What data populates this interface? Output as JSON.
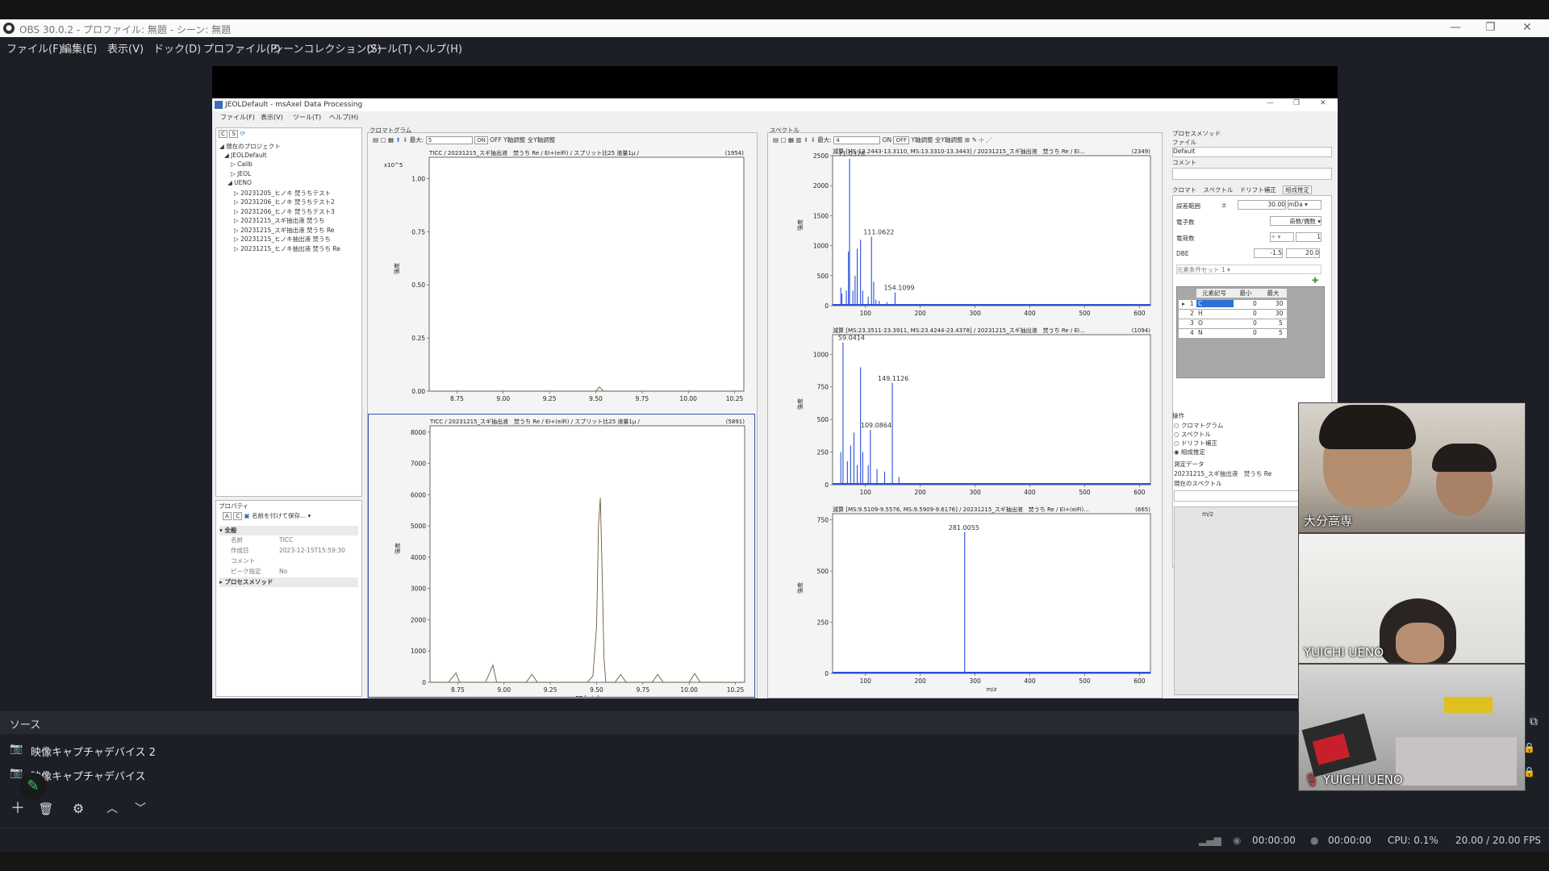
{
  "window": {
    "title": "OBS 30.0.2 - プロファイル: 無題 - シーン: 無題"
  },
  "menu": [
    "ファイル(F)",
    "編集(E)",
    "表示(V)",
    "ドック(D)",
    "プロファイル(P)",
    "シーンコレクション(S)",
    "ツール(T)",
    "ヘルプ(H)"
  ],
  "msaxel": {
    "title": "JEOLDefault - msAxel Data Processing",
    "menu": [
      "ファイル(F)",
      "表示(V)",
      "ツール(T)",
      "ヘルプ(H)"
    ],
    "tree": {
      "root": "現在のプロジェクト",
      "items": [
        "JEOLDefault",
        "Calib",
        "JEOL",
        "UENO",
        "20231205_ヒノキ 焚うちテスト",
        "20231206_ヒノキ 焚うちテスト2",
        "20231206_ヒノキ 焚うちテスト3",
        "20231215_スギ抽出液 焚うち",
        "20231215_スギ抽出液 焚うち Re",
        "20231215_ヒノキ抽出液 焚うち",
        "20231215_ヒノキ抽出液 焚うち Re"
      ]
    },
    "props": {
      "header": "プロパティ",
      "save_label": "名前を付けて保存...",
      "section": "全般",
      "rows": [
        {
          "k": "名前",
          "v": "TICC"
        },
        {
          "k": "作成日",
          "v": "2023-12-15T15:59:30"
        },
        {
          "k": "コメント",
          "v": ""
        },
        {
          "k": "ピーク指定",
          "v": "No"
        }
      ],
      "process": "プロセスメソッド"
    },
    "chrom": {
      "header": "クロマトグラム",
      "max_label": "最大:",
      "max_value": "5",
      "on": "ON",
      "off": "OFF",
      "yadjust": "Y軸調整",
      "yall": "全Y軸調整",
      "yunit_label": "強度",
      "plot1_title": "TICC / 20231215_スギ抽出液　焚うち Re / EI+(eiFi) / スプリット比25 液量1μ /",
      "plot1_count": "(1954)",
      "plot2_title": "TICC / 20231215_スギ抽出液　焚うち Re / EI+(eiFi) / スプリット比25 液量1μ /",
      "plot2_count": "(5891)",
      "exp": "x10",
      "exp_sup": "5",
      "xlabel": "RT [min]"
    },
    "spec": {
      "header": "スペクトル",
      "max_label": "最大:",
      "max_value": "4",
      "on": "ON",
      "off": "OFF",
      "yadjust": "Y軸調整",
      "yall": "全Y軸調整",
      "yunit_label": "強度",
      "s1_title": "減算 [MS:13.2443-13.3110, MS:13.3310-13.3443] / 20231215_スギ抽出液　焚うち Re / EI...",
      "s1_count": "(2349)",
      "s2_title": "減算 [MS:23.3511-23.3911, MS:23.4244-23.4378] / 20231215_スギ抽出液　焚うち Re / EI...",
      "s2_count": "(1094)",
      "s3_title": "減算 [MS:9.5109-9.5576, MS:9.5909-9.6176] / 20231215_スギ抽出液　焚うち Re / EI+(eiFi)...",
      "s3_count": "(665)",
      "xlabel": "m/z"
    },
    "method": {
      "header": "プロセスメソッド",
      "file_label": "ファイル",
      "file_value": "Default",
      "comment_label": "コメント",
      "tabs": [
        "クロマト",
        "スペクトル",
        "ドリフト補正",
        "組成推定"
      ],
      "range_label": "誤差範囲",
      "range_sign": "±",
      "range_value": "30.00",
      "range_unit": "mDa",
      "electron_label": "電子数",
      "electron_value": "奇数/偶数",
      "charge_label": "電荷数",
      "charge_sign": "+",
      "charge_value": "1",
      "dbe_label": "DBE",
      "dbe_min": "-1.5",
      "dbe_max": "20.0",
      "set_label": "元素条件セット 1",
      "table_headers": [
        "元素記号",
        "最小",
        "最大"
      ],
      "table_rows": [
        {
          "n": "1",
          "el": "C",
          "min": "0",
          "max": "30"
        },
        {
          "n": "2",
          "el": "H",
          "min": "0",
          "max": "30"
        },
        {
          "n": "3",
          "el": "O",
          "min": "0",
          "max": "5"
        },
        {
          "n": "4",
          "el": "N",
          "min": "0",
          "max": "5"
        }
      ],
      "ops_header": "操作",
      "ops": [
        "クロマトグラム",
        "スペクトル",
        "ドリフト補正",
        "組成推定"
      ],
      "data_label": "測定データ",
      "data_value": "20231215_スギ抽出液　焚うち Re",
      "current_label": "現在のスペクトル",
      "col_mz": "m/z"
    }
  },
  "chart_data": [
    {
      "type": "line",
      "title": "TICC / 20231215_スギ抽出液　焚うち Re / EI+(eiFi) / スプリット比25 液量1μ /",
      "ylabel": "強度",
      "xlim": [
        8.6,
        10.3
      ],
      "ylim": [
        0,
        1.1
      ],
      "yticks": [
        "0.00",
        "0.25",
        "0.50",
        "0.75",
        "1.00"
      ],
      "xticks": [
        "8.75",
        "9.00",
        "9.25",
        "9.50",
        "9.75",
        "10.00",
        "10.25"
      ],
      "x": [
        8.6,
        9.5,
        9.52,
        9.54,
        10.3
      ],
      "y": [
        0.0,
        0.0,
        0.02,
        0.0,
        0.0
      ]
    },
    {
      "type": "line",
      "title": "TICC / 20231215_スギ抽出液　焚うち Re / EI+(eiFi) / スプリット比25 液量1μ /",
      "ylabel": "強度",
      "xlabel": "RT [min]",
      "xlim": [
        8.6,
        10.3
      ],
      "ylim": [
        0,
        8200
      ],
      "yticks": [
        "0",
        "1000",
        "2000",
        "3000",
        "4000",
        "5000",
        "6000",
        "7000",
        "8000"
      ],
      "xticks": [
        "8.75",
        "9.00",
        "9.25",
        "9.50",
        "9.75",
        "10.00",
        "10.25"
      ],
      "x": [
        8.6,
        8.7,
        8.74,
        8.76,
        8.8,
        8.9,
        8.94,
        8.96,
        9.0,
        9.12,
        9.15,
        9.18,
        9.3,
        9.45,
        9.48,
        9.5,
        9.51,
        9.52,
        9.53,
        9.54,
        9.55,
        9.6,
        9.63,
        9.66,
        9.8,
        9.83,
        9.86,
        10.0,
        10.03,
        10.06,
        10.15,
        10.3
      ],
      "y": [
        0,
        0,
        300,
        0,
        0,
        0,
        550,
        0,
        0,
        0,
        250,
        0,
        0,
        0,
        200,
        1800,
        5000,
        5900,
        3500,
        800,
        0,
        0,
        250,
        0,
        0,
        250,
        0,
        0,
        280,
        0,
        0,
        0
      ]
    },
    {
      "type": "bar",
      "title": "減算 [MS:13.2443-13.3110, MS:13.3310-13.3443] / 20231215_スギ抽出液　焚うち Re / EI...",
      "xlim": [
        40,
        620
      ],
      "ylim": [
        0,
        2500
      ],
      "yticks": [
        "0",
        "500",
        "1000",
        "1500",
        "2000",
        "2500"
      ],
      "xticks": [
        "100",
        "200",
        "300",
        "400",
        "500",
        "600"
      ],
      "annotations": [
        "71.0378",
        "111.0622",
        "154.1099"
      ],
      "x": [
        55,
        57,
        65,
        69,
        71,
        77,
        81,
        85,
        91,
        95,
        105,
        111,
        115,
        119,
        125,
        139,
        154
      ],
      "y": [
        300,
        200,
        250,
        900,
        2450,
        250,
        500,
        950,
        1100,
        250,
        150,
        1150,
        400,
        100,
        80,
        60,
        220
      ]
    },
    {
      "type": "bar",
      "title": "減算 [MS:23.3511-23.3911, MS:23.4244-23.4378] / 20231215_スギ抽出液　焚うち Re / EI...",
      "xlim": [
        40,
        620
      ],
      "ylim": [
        0,
        1150
      ],
      "yticks": [
        "0",
        "250",
        "500",
        "750",
        "1000"
      ],
      "xticks": [
        "100",
        "200",
        "300",
        "400",
        "500",
        "600"
      ],
      "annotations": [
        "59.0414",
        "149.1126",
        "109.0864"
      ],
      "x": [
        55,
        59,
        67,
        73,
        79,
        85,
        91,
        95,
        105,
        109,
        121,
        135,
        149,
        161
      ],
      "y": [
        250,
        1090,
        180,
        300,
        400,
        150,
        900,
        250,
        150,
        420,
        120,
        100,
        780,
        60
      ]
    },
    {
      "type": "bar",
      "title": "減算 [MS:9.5109-9.5576, MS:9.5909-9.6176] / 20231215_スギ抽出液　焚うち Re / EI+(eiFi)...",
      "xlabel": "m/z",
      "xlim": [
        40,
        620
      ],
      "ylim": [
        0,
        780
      ],
      "yticks": [
        "0",
        "250",
        "500",
        "750"
      ],
      "xticks": [
        "100",
        "200",
        "300",
        "400",
        "500",
        "600"
      ],
      "annotations": [
        "281.0055"
      ],
      "x": [
        281
      ],
      "y": [
        690
      ]
    }
  ],
  "participants": [
    {
      "name": "大分高専"
    },
    {
      "name": "YUICHI UENO"
    },
    {
      "name": "YUICHI UENO"
    }
  ],
  "sources": {
    "header": "ソース",
    "items": [
      "映像キャプチャデバイス 2",
      "映像キャプチャデバイス"
    ]
  },
  "status": {
    "rec_time": "00:00:00",
    "stream_time": "00:00:00",
    "cpu": "CPU: 0.1%",
    "fps": "20.00 / 20.00 FPS"
  }
}
